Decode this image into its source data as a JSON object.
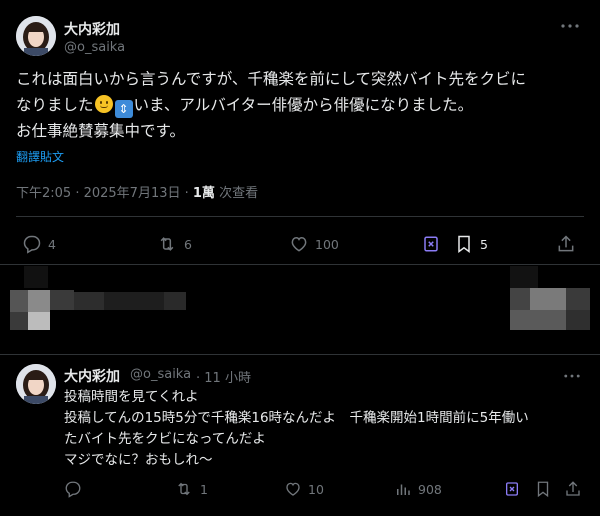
{
  "main_post": {
    "display_name": "大内彩加",
    "handle": "@o_saika",
    "text_line1": "これは面白いから言うんですが、千穐楽を前にして突然バイト先をクビに",
    "text_line2_a": "なりました",
    "text_line2_b": "いま、アルバイター俳優から俳優になりました。",
    "text_line3": "お仕事絶賛募集中です。",
    "translate_label": "翻譯貼文",
    "timestamp": "下午2:05 · 2025年7月13日 · ",
    "views_count": "1萬",
    "views_label": " 次查看",
    "replies": "4",
    "reposts": "6",
    "likes": "100",
    "bookmarks": "5"
  },
  "reply_post": {
    "display_name": "大内彩加",
    "handle": "@o_saika",
    "time": "· 11 小時",
    "text_line1": "投稿時間を見てくれよ",
    "text_line2": "投稿してんの15時5分で千穐楽16時なんだよ　千穐楽開始1時間前に5年働い",
    "text_line3": "たバイト先をクビになってんだよ",
    "text_line4": "マジでなに？おもしれ〜",
    "replies": "",
    "reposts": "1",
    "likes": "10",
    "views": "908"
  },
  "colors": {
    "background": "#000000",
    "text": "#e7e9ea",
    "secondary": "#71767b",
    "link": "#1d9bf0",
    "grok_purple": "#8b7cf6",
    "divider": "#2f3336"
  },
  "icons": [
    "more-icon",
    "reply-icon",
    "repost-icon",
    "like-icon",
    "grok-icon",
    "bookmark-icon",
    "share-icon",
    "views-icon"
  ]
}
